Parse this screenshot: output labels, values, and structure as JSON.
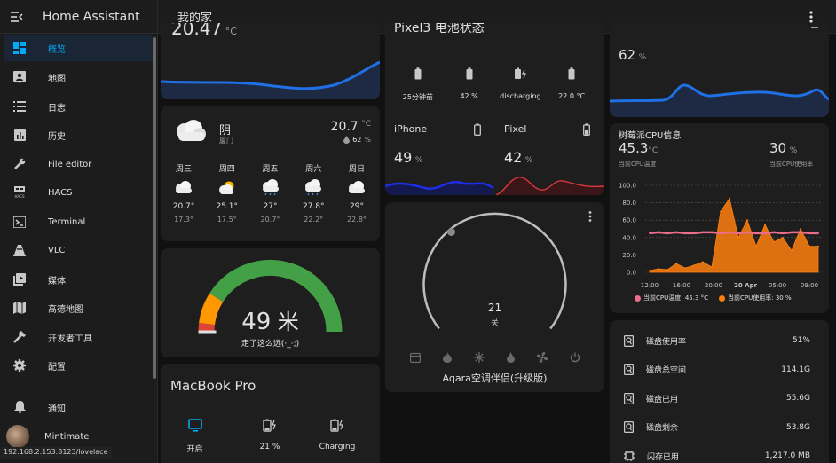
{
  "app": {
    "title": "Home Assistant",
    "page_title": "我的家",
    "url": "192.168.2.153:8123/lovelace",
    "accent": "#03a9f4"
  },
  "sidebar": {
    "items": [
      {
        "label": "概览",
        "icon": "dashboard-icon",
        "active": true
      },
      {
        "label": "地图",
        "icon": "map-account-icon"
      },
      {
        "label": "日志",
        "icon": "list-icon"
      },
      {
        "label": "历史",
        "icon": "chart-box-icon"
      },
      {
        "label": "File editor",
        "icon": "wrench-icon"
      },
      {
        "label": "HACS",
        "icon": "hacs-icon"
      },
      {
        "label": "Terminal",
        "icon": "console-icon"
      },
      {
        "label": "VLC",
        "icon": "vlc-cone-icon"
      },
      {
        "label": "媒体",
        "icon": "media-play-icon"
      },
      {
        "label": "高德地图",
        "icon": "map-icon"
      },
      {
        "label": "开发者工具",
        "icon": "hammer-icon"
      },
      {
        "label": "配置",
        "icon": "gear-icon"
      }
    ],
    "notifications": "通知",
    "user": "Mintimate"
  },
  "temp_card": {
    "value_partial": "20.47",
    "unit": "°C"
  },
  "weather": {
    "condition": "阴",
    "location": "厦门",
    "temp": "20.7",
    "temp_unit": "°C",
    "humidity": "62",
    "humidity_unit": "%",
    "forecast": [
      {
        "day": "周三",
        "hi": "20.7°",
        "lo": "17.3°",
        "icon": "cloudy-icon"
      },
      {
        "day": "周四",
        "hi": "25.1°",
        "lo": "17.5°",
        "icon": "partly-cloudy-icon"
      },
      {
        "day": "周五",
        "hi": "27°",
        "lo": "20.7°",
        "icon": "rainy-icon"
      },
      {
        "day": "周六",
        "hi": "27.8°",
        "lo": "22.2°",
        "icon": "rainy-icon"
      },
      {
        "day": "周日",
        "hi": "29°",
        "lo": "22.8°",
        "icon": "cloudy-icon"
      }
    ]
  },
  "gauge": {
    "value": "49",
    "unit": "米",
    "label": "走了这么远(·_·;)",
    "level": 0.49,
    "colors": {
      "low": "#db4437",
      "mid": "#ff9800",
      "high": "#43a047"
    }
  },
  "macbook": {
    "title": "MacBook Pro",
    "items": [
      {
        "icon": "monitor-icon",
        "label": "开启",
        "active": true
      },
      {
        "icon": "battery-charging-icon",
        "label": "21 %"
      },
      {
        "icon": "battery-charging-icon",
        "label": "Charging"
      }
    ]
  },
  "pixel_battery": {
    "title_partial": "Pixel3 电池状态",
    "items": [
      {
        "icon": "battery-icon",
        "label": "25分钟前"
      },
      {
        "icon": "battery-icon",
        "label": "42 %"
      },
      {
        "icon": "battery-charging-icon",
        "label": "discharging"
      },
      {
        "icon": "battery-icon",
        "label": "22.0 °C"
      }
    ]
  },
  "iphone": {
    "name": "iPhone",
    "value": "49",
    "unit": "%",
    "color": "#1e2ee6"
  },
  "pixel": {
    "name": "Pixel",
    "value": "42",
    "unit": "%",
    "color": "#d9363e"
  },
  "thermostat": {
    "value": "21",
    "state": "关",
    "name": "Aqara空调伴侣(升级版)",
    "modes": [
      "calendar-icon",
      "fire-icon",
      "snowflake-icon",
      "water-icon",
      "fan-icon",
      "power-icon"
    ]
  },
  "humidity_card": {
    "value": "62",
    "unit": "%"
  },
  "cpu": {
    "title": "树莓派CPU信息",
    "temp_value": "45.3",
    "temp_unit": "°C",
    "temp_label": "当前CPU温度",
    "usage_value": "30",
    "usage_unit": "%",
    "usage_label": "当前CPU使用率",
    "legend_temp": "当前CPU温度: 45.3 °C",
    "legend_usage": "当前CPU使用率: 30 %",
    "temp_color": "#ec6e8c",
    "usage_color": "#ff7f0e"
  },
  "chart_data": {
    "type": "area",
    "categories": [
      "12:00",
      "16:00",
      "20:00",
      "20 Apr",
      "05:00",
      "09:00"
    ],
    "ylim": [
      0,
      100
    ],
    "yticks": [
      "100.0",
      "80.0",
      "60.0",
      "40.0",
      "20.0",
      "0.0"
    ],
    "series": [
      {
        "name": "当前CPU温度",
        "values": [
          45,
          46,
          45,
          46,
          45,
          45,
          46,
          46,
          45,
          46,
          45,
          46,
          45,
          45,
          46,
          45,
          46,
          46,
          45,
          45
        ]
      },
      {
        "name": "当前CPU使用率",
        "values": [
          2,
          4,
          3,
          10,
          5,
          8,
          12,
          6,
          70,
          85,
          40,
          60,
          30,
          55,
          35,
          40,
          25,
          50,
          30,
          30
        ]
      }
    ],
    "grid": true,
    "legend": "bottom"
  },
  "disk": {
    "rows": [
      {
        "label": "磁盘使用率",
        "value": "51%"
      },
      {
        "label": "磁盘总空间",
        "value": "114.1G"
      },
      {
        "label": "磁盘已用",
        "value": "55.6G"
      },
      {
        "label": "磁盘剩余",
        "value": "53.8G"
      },
      {
        "label": "闪存已用",
        "value": "1,217.0 MB"
      }
    ]
  }
}
